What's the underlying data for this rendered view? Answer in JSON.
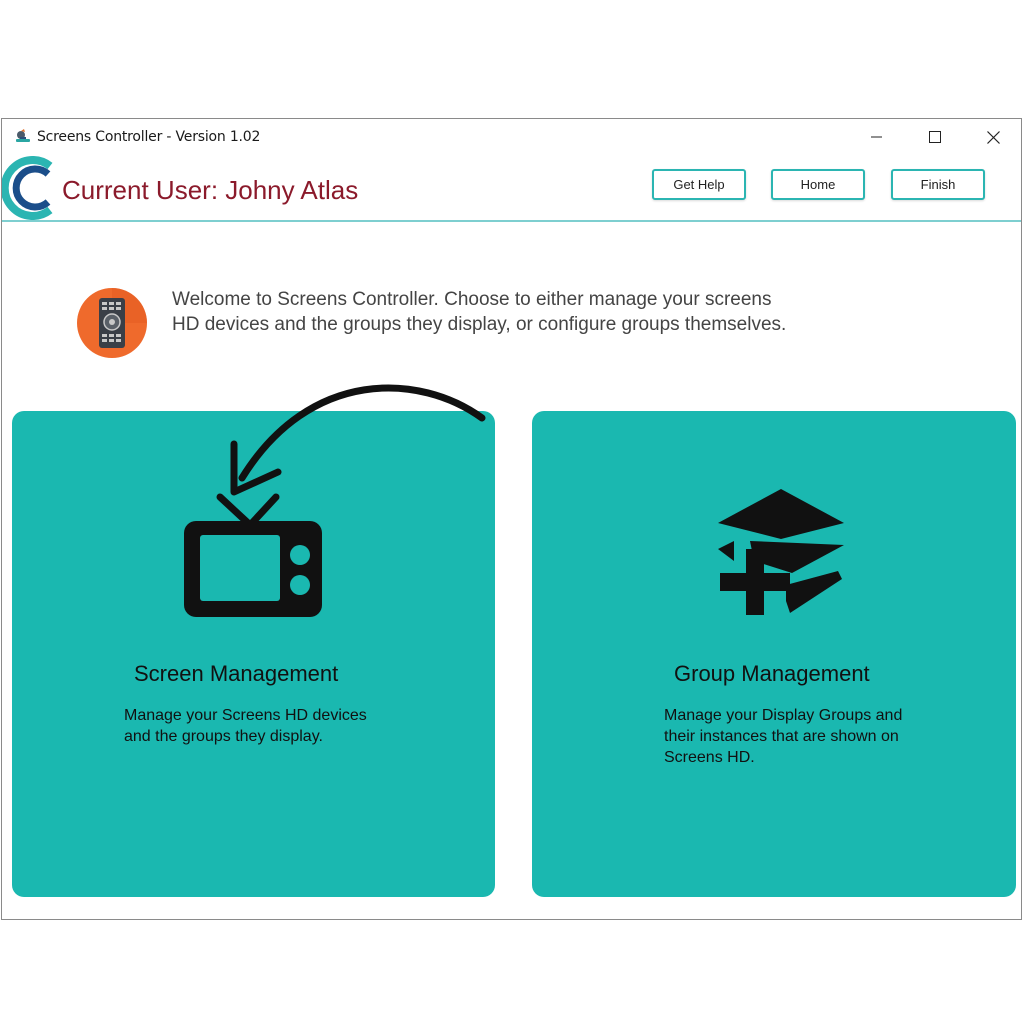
{
  "window": {
    "title": "Screens Controller - Version 1.02"
  },
  "header": {
    "current_user": "Current User: Johny Atlas",
    "buttons": {
      "help": "Get Help",
      "home": "Home",
      "finish": "Finish"
    },
    "accent_color": "#2bb5b2",
    "user_color": "#8b1a2b"
  },
  "welcome": {
    "line1": "Welcome to Screens Controller. Choose to either manage your screens",
    "line2": "HD devices and the groups they display, or configure groups themselves.",
    "icon": "remote-control-icon"
  },
  "cards": {
    "screen": {
      "title": "Screen Management",
      "desc_line1": "Manage your Screens HD devices",
      "desc_line2": "and the groups they display.",
      "icon": "tv-icon"
    },
    "group": {
      "title": "Group Management",
      "desc_line1": "Manage your Display Groups and",
      "desc_line2": "their instances that are shown on",
      "desc_line3": "Screens HD.",
      "icon": "add-layers-icon"
    },
    "card_color": "#1ab8b0"
  }
}
